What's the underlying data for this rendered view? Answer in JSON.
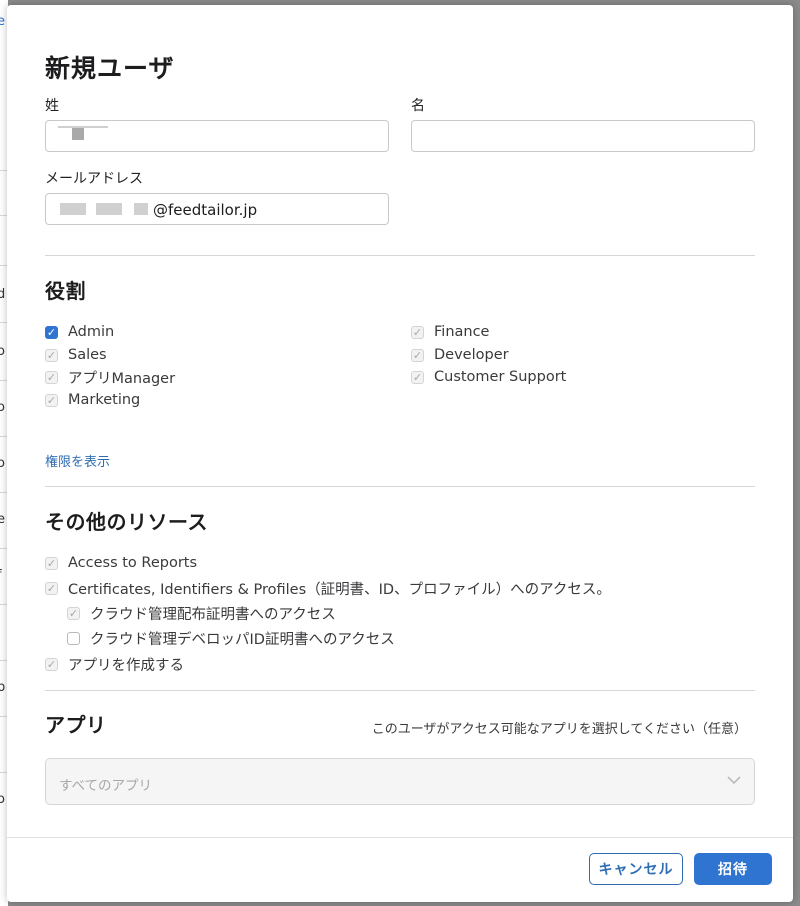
{
  "modal": {
    "title": "新規ユーザ",
    "fields": {
      "last_name_label": "姓",
      "first_name_label": "名",
      "email_label": "メールアドレス",
      "email_domain": "@feedtailor.jp"
    },
    "roles": {
      "heading": "役割",
      "items": [
        {
          "label": "Admin",
          "state": "checked"
        },
        {
          "label": "Sales",
          "state": "disabled-checked"
        },
        {
          "label": "アプリManager",
          "state": "disabled-checked"
        },
        {
          "label": "Marketing",
          "state": "disabled-checked"
        },
        {
          "label": "Finance",
          "state": "disabled-checked"
        },
        {
          "label": "Developer",
          "state": "disabled-checked"
        },
        {
          "label": "Customer Support",
          "state": "disabled-checked"
        }
      ],
      "permissions_link": "権限を表示"
    },
    "resources": {
      "heading": "その他のリソース",
      "items": [
        {
          "label": "Access to Reports",
          "state": "disabled-checked"
        },
        {
          "label": "Certificates, Identifiers & Profiles（証明書、ID、プロファイル）へのアクセス。",
          "state": "disabled-checked"
        },
        {
          "label": "クラウド管理配布証明書へのアクセス",
          "state": "disabled-checked"
        },
        {
          "label": "クラウド管理デベロッパID証明書へのアクセス",
          "state": "unchecked"
        },
        {
          "label": "アプリを作成する",
          "state": "disabled-checked"
        }
      ]
    },
    "apps": {
      "heading": "アプリ",
      "hint": "このユーザがアクセス可能なアプリを選択してください（任意）",
      "select_value": "すべてのアプリ"
    },
    "buttons": {
      "cancel": "キャンセル",
      "invite": "招待"
    }
  },
  "colors": {
    "accent": "#2f74d0",
    "link": "#2f6db3",
    "overlay": "#8a8a8a"
  },
  "icons": {
    "checkmark": "check-icon",
    "dropdown": "chevron-down-icon"
  }
}
